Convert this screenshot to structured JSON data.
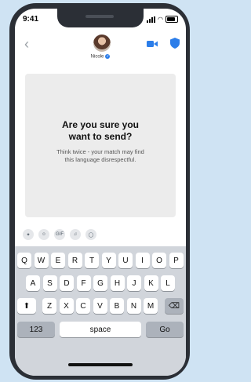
{
  "status_bar": {
    "time": "9:41"
  },
  "header": {
    "contact_name": "Nicole",
    "verified_glyph": "✓",
    "back_glyph": "‹"
  },
  "card": {
    "title_line1": "Are you sure you",
    "title_line2": "want to send?",
    "body_line1": "Think twice - your match may find",
    "body_line2": "this language disrespectful."
  },
  "app_bar": [
    {
      "name": "app-store-icon",
      "glyph": "✦"
    },
    {
      "name": "sticker-icon",
      "glyph": "☺"
    },
    {
      "name": "gif-icon",
      "glyph": "GIF"
    },
    {
      "name": "music-icon",
      "glyph": "♫"
    },
    {
      "name": "circle-app-icon",
      "glyph": "◯"
    }
  ],
  "keyboard": {
    "row1": [
      "Q",
      "W",
      "E",
      "R",
      "T",
      "Y",
      "U",
      "I",
      "O",
      "P"
    ],
    "row2": [
      "A",
      "S",
      "D",
      "F",
      "G",
      "H",
      "J",
      "K",
      "L"
    ],
    "row3": [
      "Z",
      "X",
      "C",
      "V",
      "B",
      "N",
      "M"
    ],
    "shift_glyph": "⬆",
    "delete_glyph": "⌫",
    "numbers_label": "123",
    "space_label": "space",
    "go_label": "Go"
  }
}
